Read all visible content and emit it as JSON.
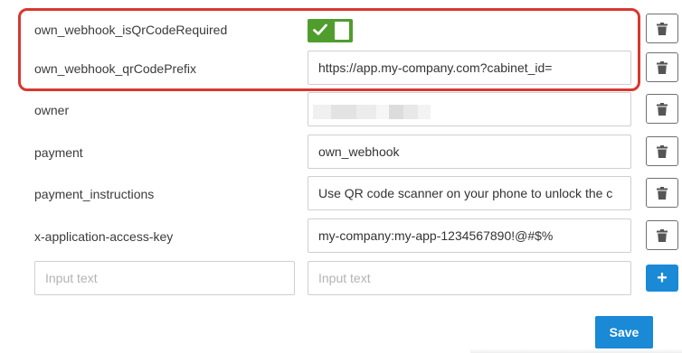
{
  "rows": [
    {
      "key": "own_webhook_isQrCodeRequired",
      "type": "toggle",
      "enabled": true
    },
    {
      "key": "own_webhook_qrCodePrefix",
      "type": "text",
      "value": "https://app.my-company.com?cabinet_id="
    },
    {
      "key": "owner",
      "type": "redacted"
    },
    {
      "key": "payment",
      "type": "text",
      "value": "own_webhook"
    },
    {
      "key": "payment_instructions",
      "type": "text",
      "value": "Use QR code scanner on your phone to unlock the c"
    },
    {
      "key": "x-application-access-key",
      "type": "text",
      "value": "my-company:my-app-1234567890!@#$%"
    }
  ],
  "new_row": {
    "key_placeholder": "Input text",
    "value_placeholder": "Input text"
  },
  "buttons": {
    "save_label": "Save"
  },
  "icons": {
    "delete": "trash-icon",
    "add": "plus-icon",
    "toggle_on": "check-icon"
  },
  "colors": {
    "primary": "#1a89d6",
    "toggle_on": "#4f9d2d",
    "highlight": "#d9372f",
    "input_border": "#cfcfcf"
  }
}
